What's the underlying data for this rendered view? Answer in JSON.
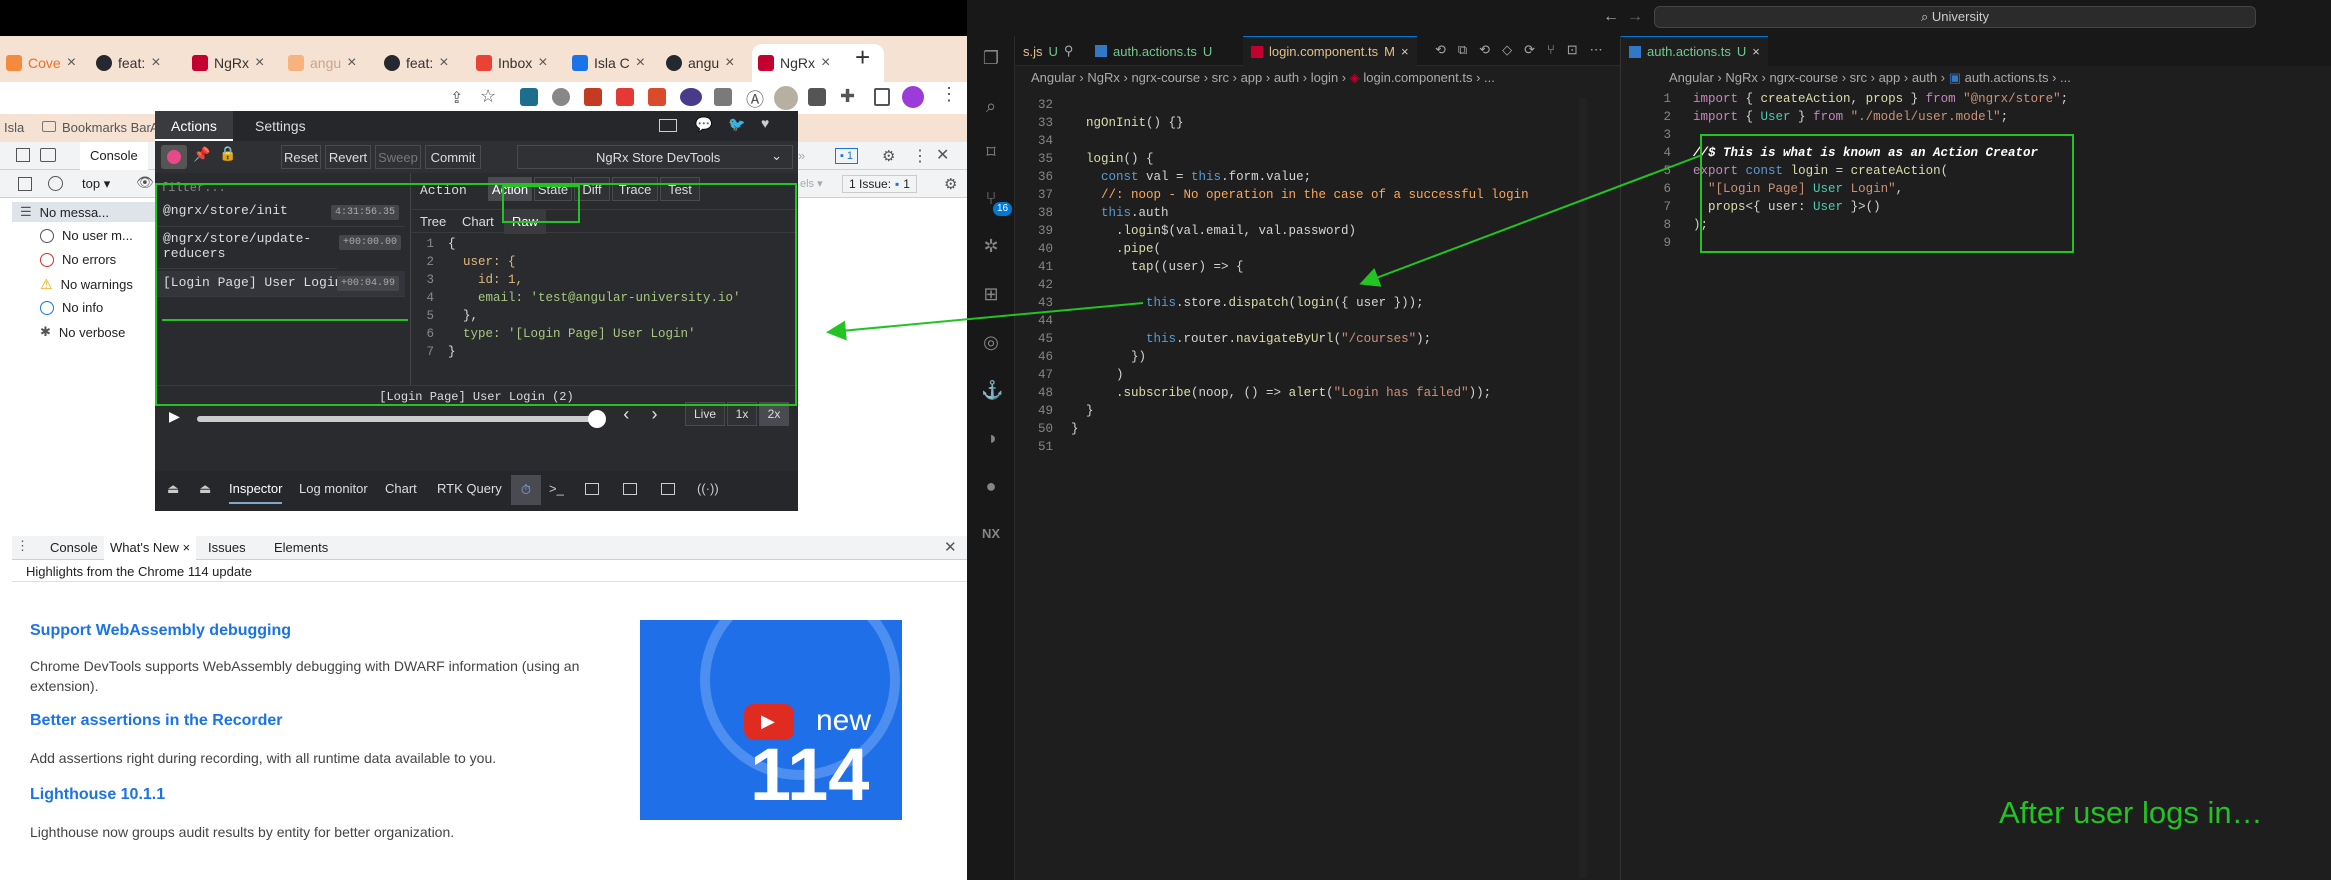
{
  "browser": {
    "tabs": [
      {
        "label": "Cove"
      },
      {
        "label": "feat:"
      },
      {
        "label": "NgRx"
      },
      {
        "label": "angu"
      },
      {
        "label": "feat:"
      },
      {
        "label": "Inbox"
      },
      {
        "label": "Isla C"
      },
      {
        "label": "angu"
      },
      {
        "label": "NgRx"
      }
    ],
    "new_tab": "+",
    "bookmarks": {
      "left": "Isla",
      "label": "Bookmarks Bar",
      "right": "Al"
    }
  },
  "devtools": {
    "tabs": [
      "Console"
    ],
    "context": "top",
    "issues_label": "1 Issue:",
    "issues_count": "1",
    "messages_count": "1",
    "sidebar": [
      {
        "label": "No messa..."
      },
      {
        "label": "No user m..."
      },
      {
        "label": "No errors"
      },
      {
        "label": "No warnings"
      },
      {
        "label": "No info"
      },
      {
        "label": "No verbose"
      }
    ],
    "drawer_tabs": [
      "Console",
      "What's New",
      "Issues",
      "Elements"
    ],
    "whats_new": {
      "subtitle": "Highlights from the Chrome 114 update",
      "items": [
        {
          "title": "Support WebAssembly debugging",
          "body": "Chrome DevTools supports WebAssembly debugging with DWARF information (using an extension)."
        },
        {
          "title": "Better assertions in the Recorder",
          "body": "Add assertions right during recording, with all runtime data available to you."
        },
        {
          "title": "Lighthouse 10.1.1",
          "body": "Lighthouse now groups audit results by entity for better organization."
        }
      ],
      "banner": {
        "new": "new",
        "version": "114"
      }
    }
  },
  "redux_devtools": {
    "top_tabs": [
      "Actions",
      "Settings"
    ],
    "buttons": [
      "Reset",
      "Revert",
      "Sweep",
      "Commit"
    ],
    "instance": "NgRx Store DevTools",
    "filter_placeholder": "filter...",
    "actions": [
      {
        "name": "@ngrx/store/init",
        "time": "4:31:56.35"
      },
      {
        "name": "@ngrx/store/update-reducers",
        "time": "+00:00.00"
      },
      {
        "name": "[Login Page] User Login",
        "time": "+00:04.99"
      }
    ],
    "panel_title": "Action",
    "monitor_tabs": [
      "Action",
      "State",
      "Diff",
      "Trace",
      "Test"
    ],
    "view_tabs": [
      "Tree",
      "Chart",
      "Raw"
    ],
    "raw_lines": [
      {
        "n": "1",
        "t": "{"
      },
      {
        "n": "2",
        "t": "  user: {"
      },
      {
        "n": "3",
        "t": "    id: 1,"
      },
      {
        "n": "4",
        "t": "    email: 'test@angular-university.io'"
      },
      {
        "n": "5",
        "t": "  },"
      },
      {
        "n": "6",
        "t": "  type: '[Login Page] User Login'"
      },
      {
        "n": "7",
        "t": "}"
      }
    ],
    "slider_label": "[Login Page] User Login (2)",
    "slider_position": 1.0,
    "speed": [
      "Live",
      "1x",
      "2x"
    ],
    "bottom_tabs": [
      "Inspector",
      "Log monitor",
      "Chart",
      "RTK Query"
    ]
  },
  "vscode": {
    "search": "University",
    "left_tabs": [
      {
        "label": "s.js",
        "status": "U"
      },
      {
        "label": "auth.actions.ts",
        "status": "U"
      },
      {
        "label": "login.component.ts",
        "status": "M"
      }
    ],
    "right_tab": {
      "label": "auth.actions.ts",
      "status": "U"
    },
    "left_breadcrumb": [
      "Angular",
      "NgRx",
      "ngrx-course",
      "src",
      "app",
      "auth",
      "login",
      "login.component.ts",
      "..."
    ],
    "right_breadcrumb": [
      "Angular",
      "NgRx",
      "ngrx-course",
      "src",
      "app",
      "auth",
      "auth.actions.ts",
      "..."
    ],
    "activity_badge": "16",
    "left_lines": [
      {
        "n": "32",
        "t": ""
      },
      {
        "n": "33",
        "t": "  ngOnInit() {}"
      },
      {
        "n": "34",
        "t": ""
      },
      {
        "n": "35",
        "t": "  login() {"
      },
      {
        "n": "36",
        "t": "    const val = this.form.value;"
      },
      {
        "n": "37",
        "t": "    //: noop - No operation in the case of a successful login"
      },
      {
        "n": "38",
        "t": "    this.auth"
      },
      {
        "n": "39",
        "t": "      .login$(val.email, val.password)"
      },
      {
        "n": "40",
        "t": "      .pipe("
      },
      {
        "n": "41",
        "t": "        tap((user) => {"
      },
      {
        "n": "42",
        "t": ""
      },
      {
        "n": "43",
        "t": "          this.store.dispatch(login({ user }));"
      },
      {
        "n": "44",
        "t": ""
      },
      {
        "n": "45",
        "t": "          this.router.navigateByUrl(\"/courses\");"
      },
      {
        "n": "46",
        "t": "        })"
      },
      {
        "n": "47",
        "t": "      )"
      },
      {
        "n": "48",
        "t": "      .subscribe(noop, () => alert(\"Login has failed\"));"
      },
      {
        "n": "49",
        "t": "  }"
      },
      {
        "n": "50",
        "t": "}"
      },
      {
        "n": "51",
        "t": ""
      }
    ],
    "right_lines": [
      {
        "n": "1",
        "t": "import { createAction, props } from \"@ngrx/store\";"
      },
      {
        "n": "2",
        "t": "import { User } from \"./model/user.model\";"
      },
      {
        "n": "3",
        "t": ""
      },
      {
        "n": "4",
        "t": "//$ This is what is known as an Action Creator"
      },
      {
        "n": "5",
        "t": "export const login = createAction("
      },
      {
        "n": "6",
        "t": "  \"[Login Page] User Login\","
      },
      {
        "n": "7",
        "t": "  props<{ user: User }>()"
      },
      {
        "n": "8",
        "t": ");"
      },
      {
        "n": "9",
        "t": ""
      }
    ],
    "caption": "After user logs in…"
  },
  "colors": {
    "annotation_green": "#22c322",
    "chrome_tab_strip": "#f6e2d3"
  }
}
